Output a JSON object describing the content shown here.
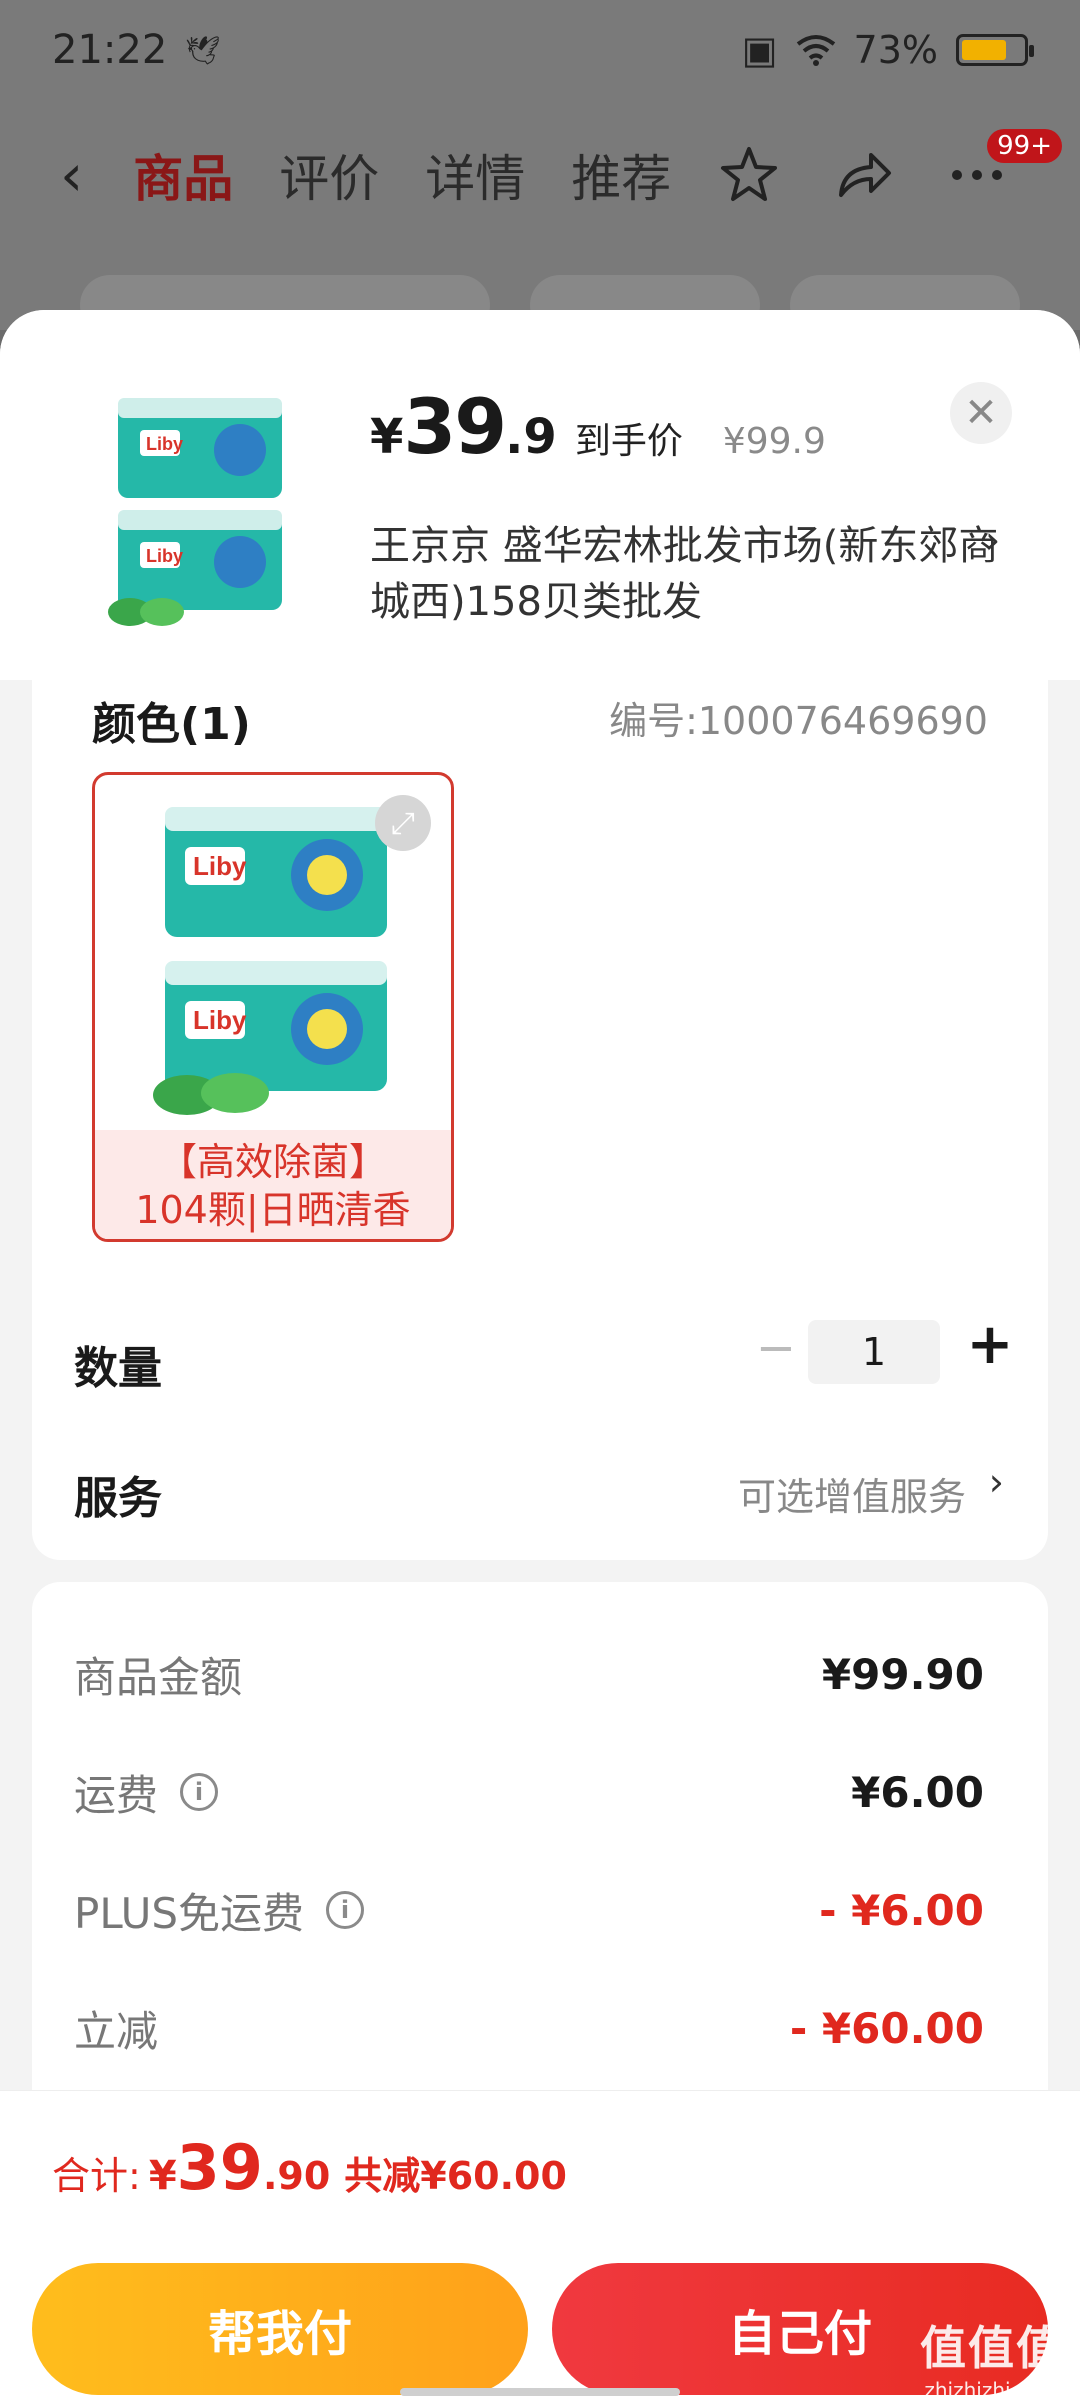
{
  "status_bar": {
    "time": "21:22",
    "battery": "73%",
    "battery_level": 0.73
  },
  "nav": {
    "tabs": [
      "商品",
      "评价",
      "详情",
      "推荐"
    ],
    "active_tab": "商品",
    "badge": "99+"
  },
  "product": {
    "price_yen": "¥",
    "price_int": "39",
    "price_dec": ".9",
    "price_tag": "到手价",
    "original_price": "¥99.9",
    "shop_address": "王京京  盛华宏林批发市场(新东郊商城西)158贝类批发"
  },
  "spec": {
    "color_label": "颜色(1)",
    "sku_number": "编号:100076469690",
    "variant_line1": "【高效除菌】",
    "variant_line2": "104颗|日晒清香"
  },
  "quantity": {
    "label": "数量",
    "minus": "−",
    "value": "1",
    "plus": "+"
  },
  "service": {
    "label": "服务",
    "value": "可选增值服务"
  },
  "fees": [
    {
      "label": "商品金额",
      "value": "¥99.90",
      "info": false,
      "red": false
    },
    {
      "label": "运费",
      "value": "¥6.00",
      "info": true,
      "red": false
    },
    {
      "label": "PLUS免运费",
      "value": "- ¥6.00",
      "info": true,
      "red": true
    },
    {
      "label": "立减",
      "value": "- ¥60.00",
      "info": false,
      "red": true
    }
  ],
  "footer": {
    "total_label": "合计:",
    "total_yen": "¥",
    "total_int": "39",
    "total_dec": ".90",
    "total_saved": "共减¥60.00",
    "help_pay": "帮我付",
    "self_pay": "自己付"
  },
  "watermark": {
    "big": "值值值",
    "small": "zhizhizhi.com"
  },
  "colors": {
    "accent_red": "#e0281e",
    "accent_yellow": "#ffb21b",
    "product_teal": "#25b8a8"
  }
}
